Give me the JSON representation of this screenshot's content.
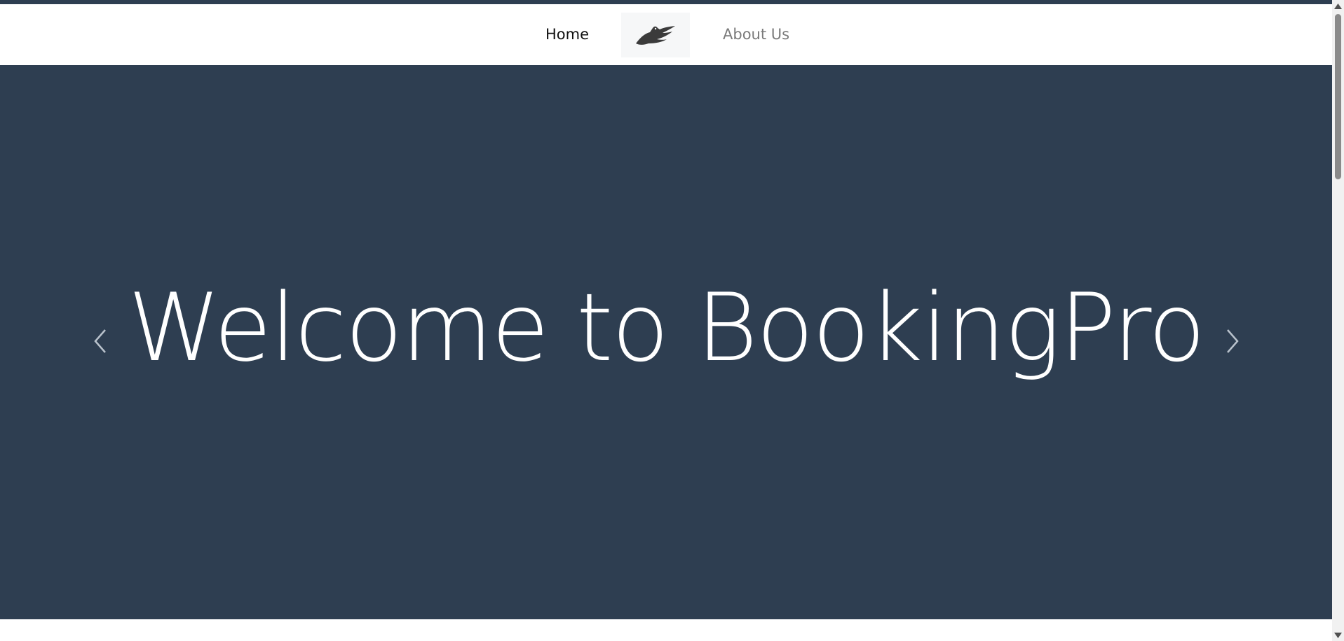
{
  "nav": {
    "home_label": "Home",
    "about_label": "About Us",
    "logo_icon": "bird-logo-icon",
    "home_color": "#111111",
    "about_color": "#7a7a7a"
  },
  "hero": {
    "title": "Welcome to BookingPro",
    "background_color": "#2e3e51",
    "prev_icon": "chevron-left-icon",
    "next_icon": "chevron-right-icon"
  },
  "scrollbar": {
    "up_icon": "scroll-up-arrow-icon",
    "down_icon": "scroll-down-arrow-icon"
  }
}
